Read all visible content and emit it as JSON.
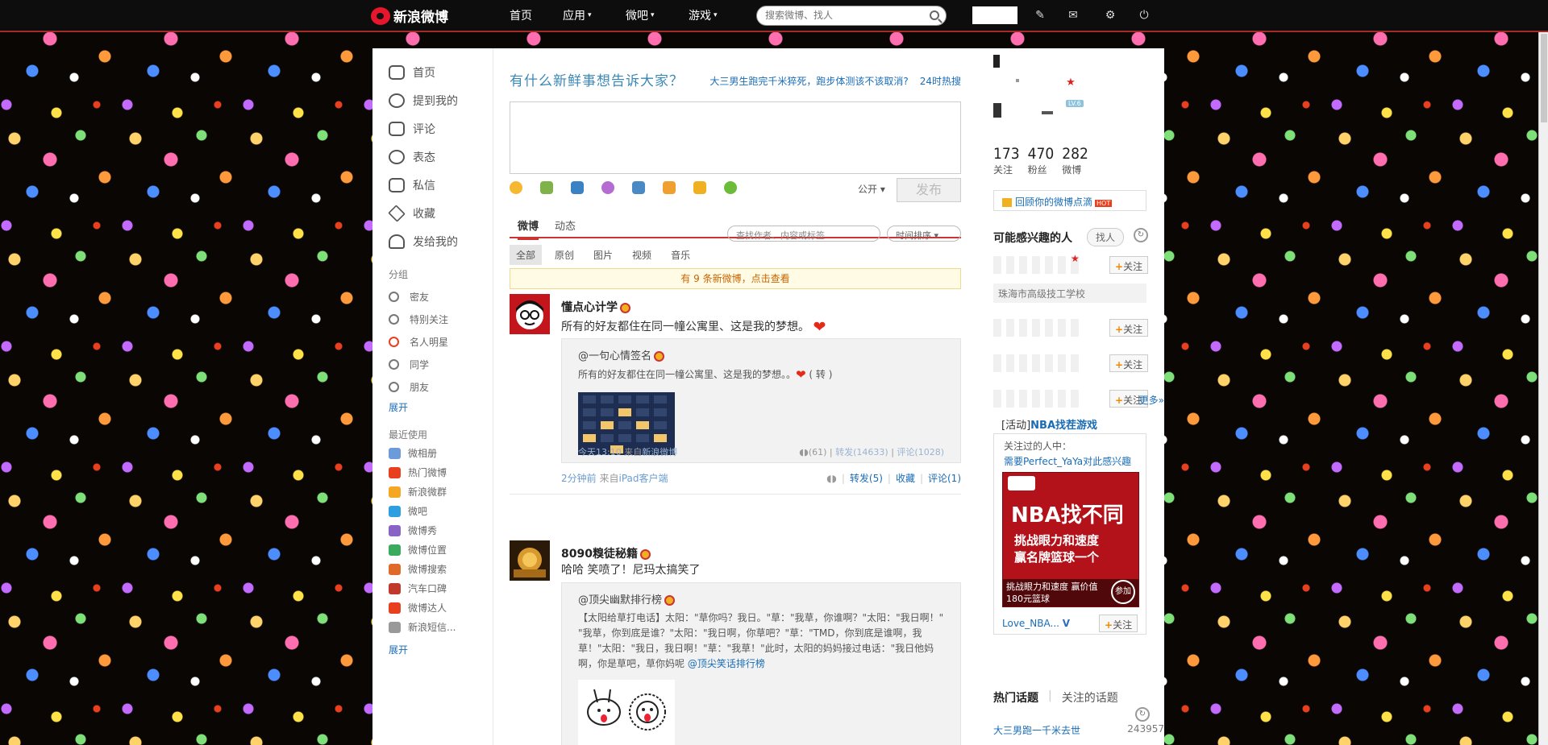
{
  "topbar": {
    "logo": "新浪微博",
    "nav": [
      {
        "label": "首页",
        "caret": ""
      },
      {
        "label": "应用",
        "caret": "▾"
      },
      {
        "label": "微吧",
        "caret": "▾"
      },
      {
        "label": "游戏",
        "caret": "▾"
      }
    ],
    "search_placeholder": "搜索微博、找人",
    "icons": [
      "edit-icon",
      "mail-icon",
      "gear-icon",
      "power-icon"
    ]
  },
  "left": {
    "main_nav": [
      "首页",
      "提到我的",
      "评论",
      "表态",
      "私信",
      "收藏",
      "发给我的"
    ],
    "group_title": "分组",
    "groups": [
      "密友",
      "特别关注",
      "名人明星",
      "同学",
      "朋友"
    ],
    "expand": "展开",
    "recent_title": "最近使用",
    "recent": [
      {
        "label": "微相册",
        "color": "#6b9bd8"
      },
      {
        "label": "热门微博",
        "color": "#e8401f"
      },
      {
        "label": "新浪微群",
        "color": "#f5a623"
      },
      {
        "label": "微吧",
        "color": "#2d9fe0"
      },
      {
        "label": "微博秀",
        "color": "#8a63c7"
      },
      {
        "label": "微博位置",
        "color": "#3aaa5c"
      },
      {
        "label": "微博搜索",
        "color": "#e06a2a"
      },
      {
        "label": "汽车口碑",
        "color": "#c0392b"
      },
      {
        "label": "微博达人",
        "color": "#e8401f"
      },
      {
        "label": "新浪短信...",
        "color": "#999999"
      }
    ],
    "expand2": "展开"
  },
  "publisher": {
    "title": "有什么新鲜事想告诉大家？",
    "hot_topic": "大三男生跑完千米猝死，跑步体测该不该取消?",
    "hot_label": "24时热搜",
    "visibility": "公开 ▾",
    "submit": "发布",
    "tools": [
      "emoji-icon",
      "image-icon",
      "video-icon",
      "music-icon",
      "topic-icon",
      "vote-icon",
      "gift-icon",
      "more-icon"
    ]
  },
  "tabs": {
    "main": [
      "微博",
      "动态"
    ],
    "filter_placeholder": "查找作者、内容或标签",
    "sort": "时间排序 ▾",
    "sub": [
      "全部",
      "原创",
      "图片",
      "视频",
      "音乐"
    ],
    "new_notice": "有 9 条新微博，点击查看"
  },
  "posts": [
    {
      "user": "懂点心计学",
      "text": "所有的好友都住在同一幢公寓里、这是我的梦想。",
      "repost": {
        "user": "@一句心情签名",
        "text": "所有的好友都住在同一幢公寓里、这是我的梦想。。",
        "suffix": "( 转 )",
        "time": "今天13:10",
        "from_label": "来自",
        "source": "新浪微博",
        "likes": "(61)",
        "forward": "转发(14633)",
        "comment": "评论(1028)"
      },
      "time": "2分钟前",
      "from_label": "来自",
      "source": "iPad客户端",
      "forward": "转发(5)",
      "fav": "收藏",
      "comment": "评论(1)"
    },
    {
      "user": "8090糗徒秘籍",
      "text": "哈哈 笑喷了！尼玛太搞笑了",
      "repost": {
        "user": "@顶尖幽默排行榜",
        "text_lines": [
          "【太阳给草打电话】太阳：\"草你吗？我日。\"草：\"我草，你谁啊？\"太阳：\"我日啊！\"",
          "\"我草，你到底是谁？\"太阳：\"我日啊，你草吧？\"草：\"TMD，你到底是谁啊，我",
          "草！\"太阳：\"我日，我日啊！\"草：\"我草！\"此时，太阳的妈妈接过电话：\"我日他妈",
          "啊，你是草吧，草你妈呢"
        ],
        "mention": "@顶尖笑话排行榜"
      }
    }
  ],
  "right": {
    "stats": [
      {
        "num": "173",
        "label": "关注"
      },
      {
        "num": "470",
        "label": "粉丝"
      },
      {
        "num": "282",
        "label": "微博"
      }
    ],
    "level": "LV.6",
    "recall": "回顾你的微博点滴",
    "hot_tag": "HOT",
    "suggest_title": "可能感兴趣的人",
    "find_btn": "找人",
    "follow_label": "关注",
    "school": "珠海市高级技工学校",
    "more": "更多»",
    "activity_prefix": "[活动]",
    "activity_name": "NBA找茬游戏",
    "activity_l1": "关注过的人中：",
    "activity_l2": "需要Perfect_YaYa对此感兴趣",
    "ad_title": "NBA找不同",
    "ad_sub1": "挑战眼力和速度",
    "ad_sub2": "赢名牌篮球一个",
    "ad_caption1": "挑战眼力和速度 赢价值",
    "ad_caption2": "180元篮球",
    "ad_join": "参加",
    "activity_user": "Love_NBA...",
    "topic_tabs": [
      "热门话题",
      "关注的话题"
    ],
    "topic_name": "大三男跑一千米去世",
    "topic_count": "243957"
  }
}
